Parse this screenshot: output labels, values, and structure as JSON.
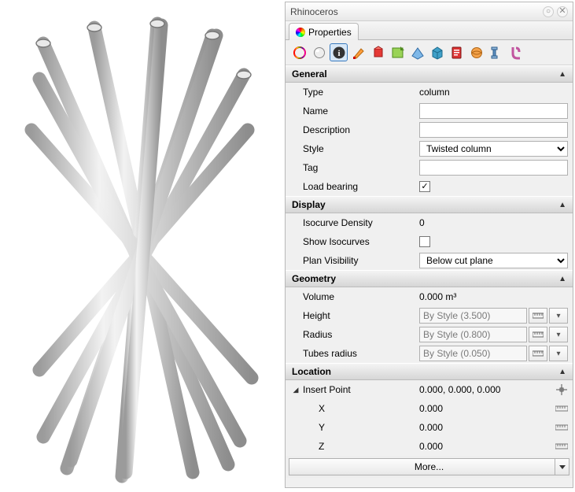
{
  "app": {
    "title": "Rhinoceros"
  },
  "tabs": [
    {
      "label": "Properties"
    }
  ],
  "sections": {
    "general": {
      "title": "General",
      "type_label": "Type",
      "type_value": "column",
      "name_label": "Name",
      "name_value": "",
      "desc_label": "Description",
      "desc_value": "",
      "style_label": "Style",
      "style_value": "Twisted column",
      "tag_label": "Tag",
      "tag_value": "",
      "load_label": "Load bearing",
      "load_checked": true
    },
    "display": {
      "title": "Display",
      "iso_label": "Isocurve Density",
      "iso_value": "0",
      "show_label": "Show Isocurves",
      "show_checked": false,
      "vis_label": "Plan Visibility",
      "vis_value": "Below cut plane"
    },
    "geometry": {
      "title": "Geometry",
      "vol_label": "Volume",
      "vol_value": "0.000 m³",
      "h_label": "Height",
      "h_value": "By Style (3.500)",
      "r_label": "Radius",
      "r_value": "By Style (0.800)",
      "tr_label": "Tubes radius",
      "tr_value": "By Style (0.050)"
    },
    "location": {
      "title": "Location",
      "ip_label": "Insert Point",
      "ip_value": "0.000, 0.000, 0.000",
      "x_label": "X",
      "x_value": "0.000",
      "y_label": "Y",
      "y_value": "0.000",
      "z_label": "Z",
      "z_value": "0.000"
    }
  },
  "more_label": "More..."
}
